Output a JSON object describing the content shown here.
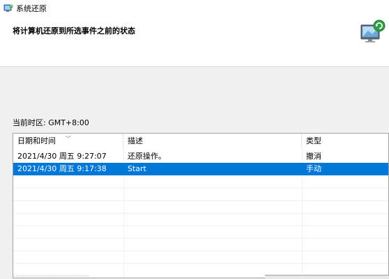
{
  "window": {
    "title": "系统还原",
    "icon": "system-restore-icon"
  },
  "header": {
    "subtitle": "将计算机还原到所选事件之前的状态",
    "illustration": "restore-computer-icon"
  },
  "timezone": "当前时区: GMT+8:00",
  "table": {
    "columns": [
      "日期和时间",
      "描述",
      "类型"
    ],
    "rows": [
      {
        "datetime": "2021/4/30 周五 9:27:07",
        "description": "还原操作。",
        "type": "撤消",
        "selected": false
      },
      {
        "datetime": "2021/4/30 周五 9:17:38",
        "description": "Start",
        "type": "手动",
        "selected": true
      }
    ]
  },
  "colors": {
    "selection": "#0078d7",
    "header_bg": "#ffffff",
    "body_bg": "#f0f0f0"
  }
}
